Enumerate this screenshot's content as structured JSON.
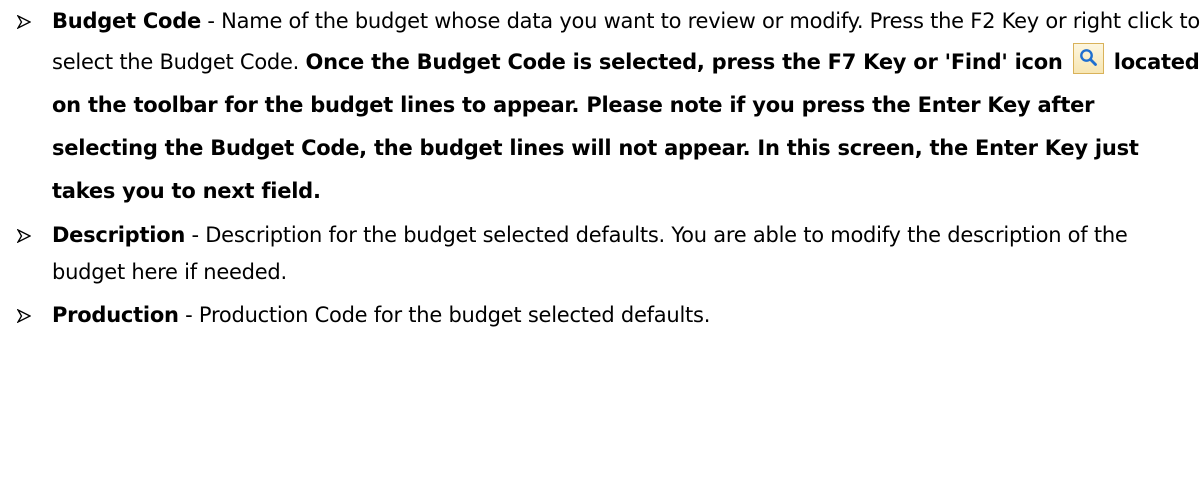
{
  "items": [
    {
      "term": "Budget Code",
      "sep": " - ",
      "text": "Name of the budget whose data you want to review or modify. Press the F2 Key or right click to select the Budget Code.  ",
      "note_before_icon": "Once the Budget Code is selected, press the F7 Key or 'Find' icon ",
      "icon": "search-icon",
      "note_after_icon": " located on the toolbar for the budget lines to appear. Please note if you press the Enter Key after selecting the Budget Code, the budget lines will not appear.  In this screen, the Enter Key just takes you to next field."
    },
    {
      "term": "Description",
      "sep": " - ",
      "text": "Description for the budget selected defaults.  You are able to modify the description of the budget here if needed."
    },
    {
      "term": "Production",
      "sep": " - ",
      "text": "Production Code for the budget selected defaults."
    }
  ],
  "colors": {
    "icon_border": "#d9b25a",
    "icon_fill": "#f7e6b3",
    "icon_glyph": "#1f6fd0"
  }
}
